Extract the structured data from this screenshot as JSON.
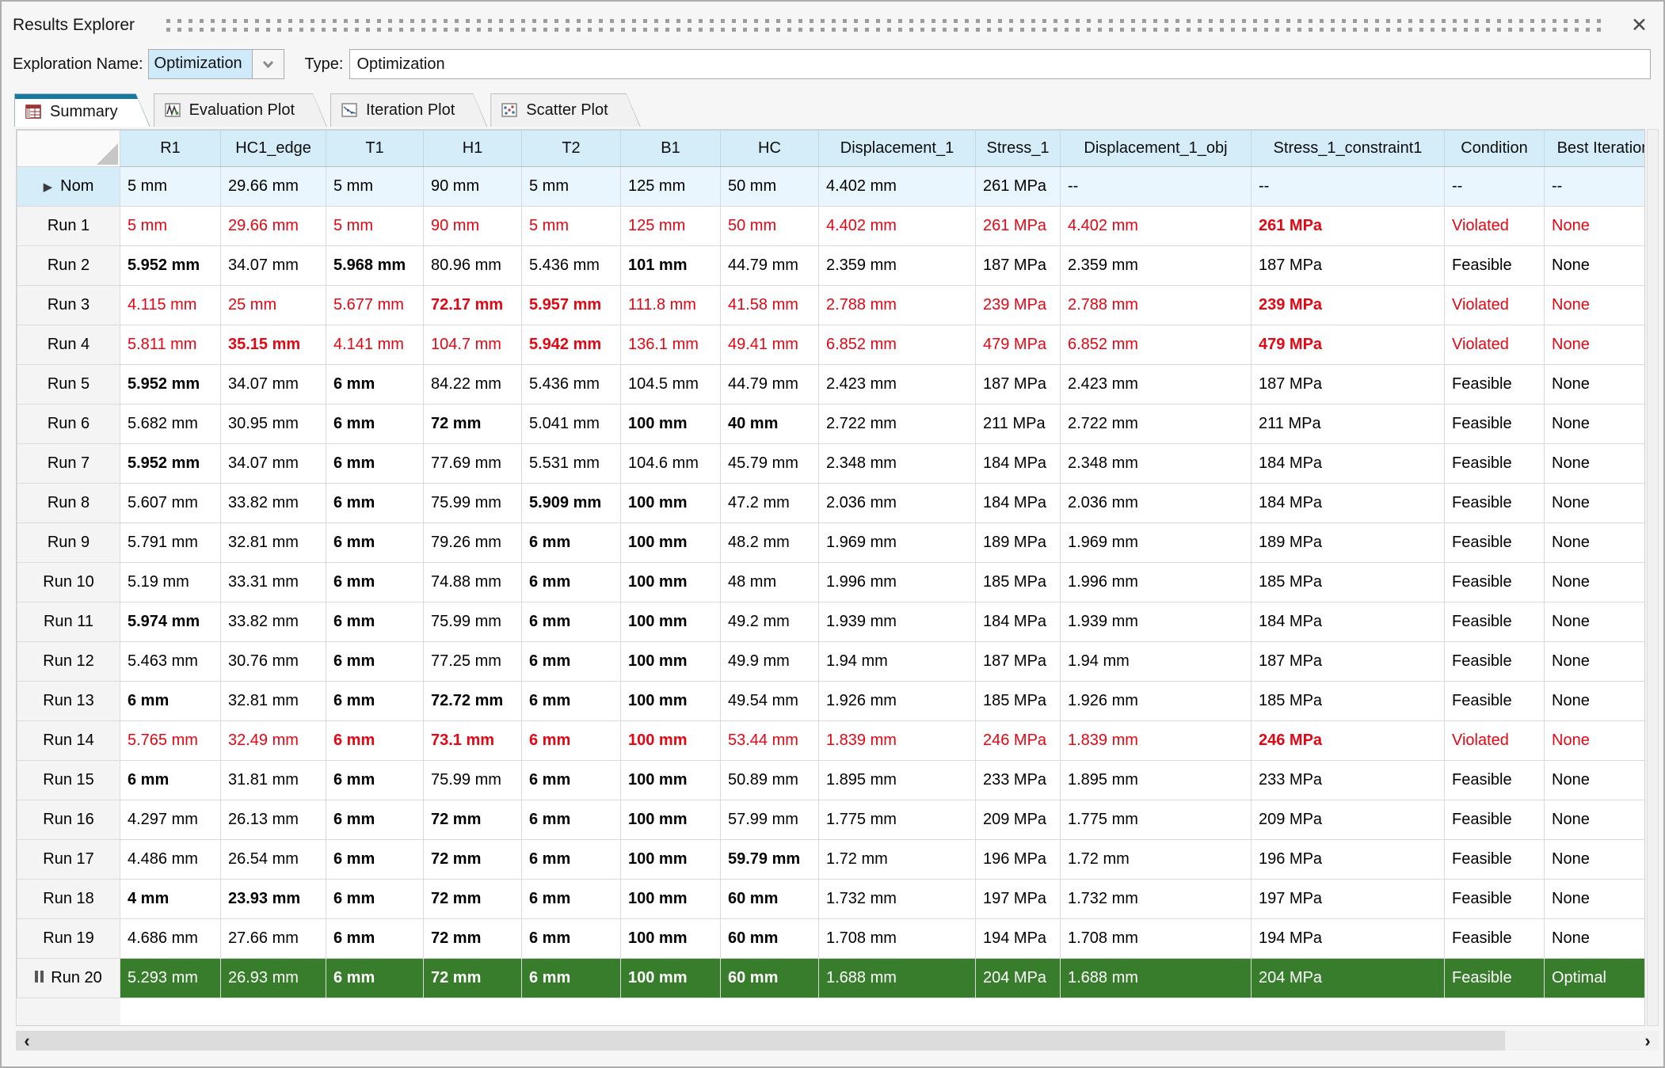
{
  "window": {
    "title": "Results Explorer"
  },
  "icons": {
    "close": "✕",
    "chevron_down": "⌄",
    "scroll_left": "‹",
    "scroll_right": "›",
    "play": "▶"
  },
  "colors": {
    "violated_red": "#e30613",
    "optimal_green": "#377d2b",
    "header_blue": "#d5edf9",
    "nominal_blue": "#eaf6fd",
    "active_tab_accent": "#17799e",
    "combo_selection_blue": "#cfeafa"
  },
  "toolbar": {
    "exploration_name_label": "Exploration Name:",
    "exploration_name_value": "Optimization",
    "type_label": "Type:",
    "type_value": "Optimization"
  },
  "tabs": [
    {
      "label": "Summary",
      "icon": "summary-table-icon",
      "active": true
    },
    {
      "label": "Evaluation Plot",
      "icon": "evaluation-plot-icon",
      "active": false
    },
    {
      "label": "Iteration Plot",
      "icon": "iteration-plot-icon",
      "active": false
    },
    {
      "label": "Scatter Plot",
      "icon": "scatter-plot-icon",
      "active": false
    }
  ],
  "table": {
    "columns": [
      "R1",
      "HC1_edge",
      "T1",
      "H1",
      "T2",
      "B1",
      "HC",
      "Displacement_1",
      "Stress_1",
      "Displacement_1_obj",
      "Stress_1_constraint1",
      "Condition",
      "Best Iteration"
    ],
    "rows": [
      {
        "label": "Nom",
        "icon": "play",
        "state": "nominal",
        "values": [
          "5 mm",
          "29.66 mm",
          "5 mm",
          "90 mm",
          "5 mm",
          "125 mm",
          "50 mm",
          "4.402 mm",
          "261 MPa",
          "--",
          "--",
          "--",
          "--"
        ],
        "bold": []
      },
      {
        "label": "Run 1",
        "icon": null,
        "state": "violated",
        "values": [
          "5 mm",
          "29.66 mm",
          "5 mm",
          "90 mm",
          "5 mm",
          "125 mm",
          "50 mm",
          "4.402 mm",
          "261 MPa",
          "4.402 mm",
          "261 MPa",
          "Violated",
          "None"
        ],
        "bold": [
          10
        ]
      },
      {
        "label": "Run 2",
        "icon": null,
        "state": "feasible",
        "values": [
          "5.952 mm",
          "34.07 mm",
          "5.968 mm",
          "80.96 mm",
          "5.436 mm",
          "101 mm",
          "44.79 mm",
          "2.359 mm",
          "187 MPa",
          "2.359 mm",
          "187 MPa",
          "Feasible",
          "None"
        ],
        "bold": [
          0,
          2,
          5
        ]
      },
      {
        "label": "Run 3",
        "icon": null,
        "state": "violated",
        "values": [
          "4.115 mm",
          "25 mm",
          "5.677 mm",
          "72.17 mm",
          "5.957 mm",
          "111.8 mm",
          "41.58 mm",
          "2.788 mm",
          "239 MPa",
          "2.788 mm",
          "239 MPa",
          "Violated",
          "None"
        ],
        "bold": [
          3,
          4,
          10
        ]
      },
      {
        "label": "Run 4",
        "icon": null,
        "state": "violated",
        "values": [
          "5.811 mm",
          "35.15 mm",
          "4.141 mm",
          "104.7 mm",
          "5.942 mm",
          "136.1 mm",
          "49.41 mm",
          "6.852 mm",
          "479 MPa",
          "6.852 mm",
          "479 MPa",
          "Violated",
          "None"
        ],
        "bold": [
          1,
          4,
          10
        ]
      },
      {
        "label": "Run 5",
        "icon": null,
        "state": "feasible",
        "values": [
          "5.952 mm",
          "34.07 mm",
          "6 mm",
          "84.22 mm",
          "5.436 mm",
          "104.5 mm",
          "44.79 mm",
          "2.423 mm",
          "187 MPa",
          "2.423 mm",
          "187 MPa",
          "Feasible",
          "None"
        ],
        "bold": [
          0,
          2
        ]
      },
      {
        "label": "Run 6",
        "icon": null,
        "state": "feasible",
        "values": [
          "5.682 mm",
          "30.95 mm",
          "6 mm",
          "72 mm",
          "5.041 mm",
          "100 mm",
          "40 mm",
          "2.722 mm",
          "211 MPa",
          "2.722 mm",
          "211 MPa",
          "Feasible",
          "None"
        ],
        "bold": [
          2,
          3,
          5,
          6
        ]
      },
      {
        "label": "Run 7",
        "icon": null,
        "state": "feasible",
        "values": [
          "5.952 mm",
          "34.07 mm",
          "6 mm",
          "77.69 mm",
          "5.531 mm",
          "104.6 mm",
          "45.79 mm",
          "2.348 mm",
          "184 MPa",
          "2.348 mm",
          "184 MPa",
          "Feasible",
          "None"
        ],
        "bold": [
          0,
          2
        ]
      },
      {
        "label": "Run 8",
        "icon": null,
        "state": "feasible",
        "values": [
          "5.607 mm",
          "33.82 mm",
          "6 mm",
          "75.99 mm",
          "5.909 mm",
          "100 mm",
          "47.2 mm",
          "2.036 mm",
          "184 MPa",
          "2.036 mm",
          "184 MPa",
          "Feasible",
          "None"
        ],
        "bold": [
          2,
          4,
          5
        ]
      },
      {
        "label": "Run 9",
        "icon": null,
        "state": "feasible",
        "values": [
          "5.791 mm",
          "32.81 mm",
          "6 mm",
          "79.26 mm",
          "6 mm",
          "100 mm",
          "48.2 mm",
          "1.969 mm",
          "189 MPa",
          "1.969 mm",
          "189 MPa",
          "Feasible",
          "None"
        ],
        "bold": [
          2,
          4,
          5
        ]
      },
      {
        "label": "Run 10",
        "icon": null,
        "state": "feasible",
        "values": [
          "5.19 mm",
          "33.31 mm",
          "6 mm",
          "74.88 mm",
          "6 mm",
          "100 mm",
          "48 mm",
          "1.996 mm",
          "185 MPa",
          "1.996 mm",
          "185 MPa",
          "Feasible",
          "None"
        ],
        "bold": [
          2,
          4,
          5
        ]
      },
      {
        "label": "Run 11",
        "icon": null,
        "state": "feasible",
        "values": [
          "5.974 mm",
          "33.82 mm",
          "6 mm",
          "75.99 mm",
          "6 mm",
          "100 mm",
          "49.2 mm",
          "1.939 mm",
          "184 MPa",
          "1.939 mm",
          "184 MPa",
          "Feasible",
          "None"
        ],
        "bold": [
          0,
          2,
          4,
          5
        ]
      },
      {
        "label": "Run 12",
        "icon": null,
        "state": "feasible",
        "values": [
          "5.463 mm",
          "30.76 mm",
          "6 mm",
          "77.25 mm",
          "6 mm",
          "100 mm",
          "49.9 mm",
          "1.94 mm",
          "187 MPa",
          "1.94 mm",
          "187 MPa",
          "Feasible",
          "None"
        ],
        "bold": [
          2,
          4,
          5
        ]
      },
      {
        "label": "Run 13",
        "icon": null,
        "state": "feasible",
        "values": [
          "6 mm",
          "32.81 mm",
          "6 mm",
          "72.72 mm",
          "6 mm",
          "100 mm",
          "49.54 mm",
          "1.926 mm",
          "185 MPa",
          "1.926 mm",
          "185 MPa",
          "Feasible",
          "None"
        ],
        "bold": [
          0,
          2,
          3,
          4,
          5
        ]
      },
      {
        "label": "Run 14",
        "icon": null,
        "state": "violated",
        "values": [
          "5.765 mm",
          "32.49 mm",
          "6 mm",
          "73.1 mm",
          "6 mm",
          "100 mm",
          "53.44 mm",
          "1.839 mm",
          "246 MPa",
          "1.839 mm",
          "246 MPa",
          "Violated",
          "None"
        ],
        "bold": [
          2,
          3,
          4,
          5,
          10
        ]
      },
      {
        "label": "Run 15",
        "icon": null,
        "state": "feasible",
        "values": [
          "6 mm",
          "31.81 mm",
          "6 mm",
          "75.99 mm",
          "6 mm",
          "100 mm",
          "50.89 mm",
          "1.895 mm",
          "233 MPa",
          "1.895 mm",
          "233 MPa",
          "Feasible",
          "None"
        ],
        "bold": [
          0,
          2,
          4,
          5
        ]
      },
      {
        "label": "Run 16",
        "icon": null,
        "state": "feasible",
        "values": [
          "4.297 mm",
          "26.13 mm",
          "6 mm",
          "72 mm",
          "6 mm",
          "100 mm",
          "57.99 mm",
          "1.775 mm",
          "209 MPa",
          "1.775 mm",
          "209 MPa",
          "Feasible",
          "None"
        ],
        "bold": [
          2,
          3,
          4,
          5
        ]
      },
      {
        "label": "Run 17",
        "icon": null,
        "state": "feasible",
        "values": [
          "4.486 mm",
          "26.54 mm",
          "6 mm",
          "72 mm",
          "6 mm",
          "100 mm",
          "59.79 mm",
          "1.72 mm",
          "196 MPa",
          "1.72 mm",
          "196 MPa",
          "Feasible",
          "None"
        ],
        "bold": [
          2,
          3,
          4,
          5,
          6
        ]
      },
      {
        "label": "Run 18",
        "icon": null,
        "state": "feasible",
        "values": [
          "4 mm",
          "23.93 mm",
          "6 mm",
          "72 mm",
          "6 mm",
          "100 mm",
          "60 mm",
          "1.732 mm",
          "197 MPa",
          "1.732 mm",
          "197 MPa",
          "Feasible",
          "None"
        ],
        "bold": [
          0,
          1,
          2,
          3,
          4,
          5,
          6
        ]
      },
      {
        "label": "Run 19",
        "icon": null,
        "state": "feasible",
        "values": [
          "4.686 mm",
          "27.66 mm",
          "6 mm",
          "72 mm",
          "6 mm",
          "100 mm",
          "60 mm",
          "1.708 mm",
          "194 MPa",
          "1.708 mm",
          "194 MPa",
          "Feasible",
          "None"
        ],
        "bold": [
          2,
          3,
          4,
          5,
          6
        ]
      },
      {
        "label": "Run 20",
        "icon": "pause",
        "state": "optimal",
        "values": [
          "5.293 mm",
          "26.93 mm",
          "6 mm",
          "72 mm",
          "6 mm",
          "100 mm",
          "60 mm",
          "1.688 mm",
          "204 MPa",
          "1.688 mm",
          "204 MPa",
          "Feasible",
          "Optimal"
        ],
        "bold": [
          2,
          3,
          4,
          5,
          6
        ]
      }
    ]
  }
}
